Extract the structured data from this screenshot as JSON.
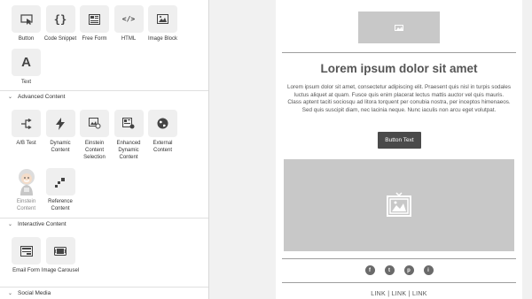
{
  "panel": {
    "basic_items": [
      {
        "label": "Button",
        "icon": "cursor-button-icon"
      },
      {
        "label": "Code Snippet",
        "icon": "curly-braces-icon"
      },
      {
        "label": "Free Form",
        "icon": "free-form-icon"
      },
      {
        "label": "HTML",
        "icon": "code-tag-icon"
      },
      {
        "label": "Image Block",
        "icon": "image-icon"
      }
    ],
    "text_item": {
      "label": "Text",
      "glyph": "A"
    },
    "sections": {
      "advanced": "Advanced Content",
      "interactive": "Interactive Content",
      "social": "Social Media"
    },
    "advanced_items": [
      {
        "label": "A/B Test",
        "icon": "split-arrow-icon"
      },
      {
        "label": "Dynamic Content",
        "icon": "lightning-icon"
      },
      {
        "label": "Einstein Content Selection",
        "icon": "image-search-icon"
      },
      {
        "label": "Enhanced Dynamic Content",
        "icon": "enhanced-content-icon"
      },
      {
        "label": "External Content",
        "icon": "globe-icon"
      }
    ],
    "advanced_items_row2": [
      {
        "label": "Einstein Content",
        "icon": "einstein-avatar-icon"
      },
      {
        "label": "Reference Content",
        "icon": "reference-icon"
      }
    ],
    "interactive_items": [
      {
        "label": "Email Form",
        "icon": "email-form-icon"
      },
      {
        "label": "Image Carousel",
        "icon": "carousel-icon"
      }
    ]
  },
  "email": {
    "title": "Lorem ipsum dolor sit amet",
    "body": "Lorem ipsum dolor sit amet, consectetur adipiscing elit. Praesent quis nisl in turpis sodales luctus aliquet at quam. Fusce quis enim placerat lectus mattis auctor vel quis mauris. Class aptent taciti sociosqu ad litora torquent per conubia nostra, per inceptos himenaeos. Sed quis suscipit diam, nec lacinia neque. Nunc iaculis non arcu eget volutpat.",
    "button_label": "Button Text",
    "social": [
      "f",
      "t",
      "p",
      "i"
    ],
    "links": "LINK  |  LINK  |  LINK"
  }
}
